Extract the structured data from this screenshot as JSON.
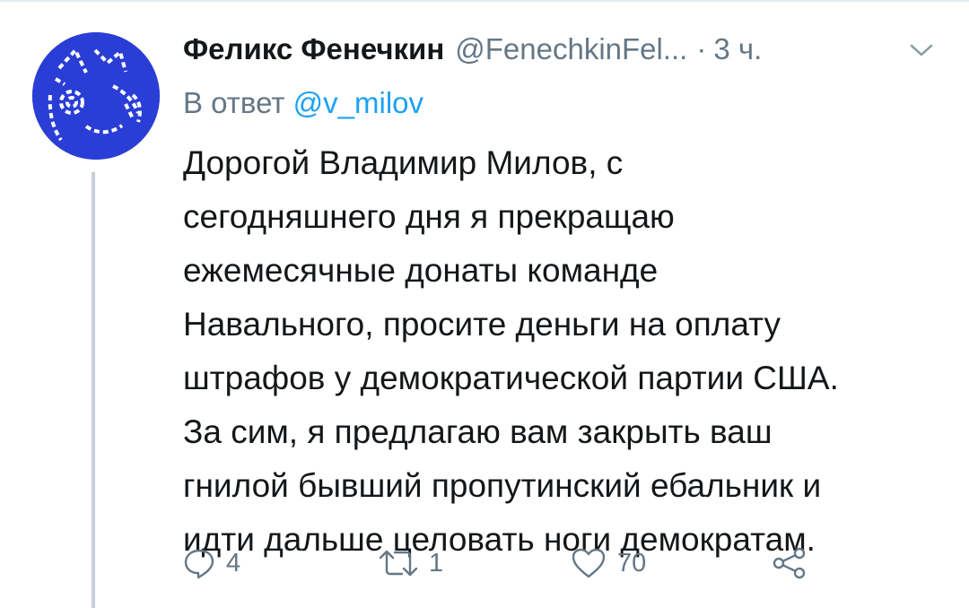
{
  "tweet": {
    "author_name": "Феликс Фенечкин",
    "author_handle": "@FenechkinFel...",
    "separator": "·",
    "time": "3 ч.",
    "reply_prefix": "В ответ",
    "reply_mention": "@v_milov",
    "text_lines": [
      "Дорогой Владимир Милов, с",
      "сегодняшнего дня я прекращаю",
      "ежемесячные донаты команде",
      "Навального, просите деньги на оплату",
      "штрафов у демократической партии США.",
      "За сим, я предлагаю вам закрыть ваш",
      "гнилой бывший пропутинский ебальник и",
      "идти дальше целовать ноги демократам."
    ]
  },
  "actions": {
    "reply_count": "4",
    "retweet_count": "1",
    "like_count": "70"
  },
  "colors": {
    "avatar_bg": "#2a3ed6",
    "secondary_text": "#657786",
    "link": "#1da1f2",
    "thread_line": "#c7d0d8"
  },
  "icons": [
    "caret-down-icon",
    "reply-icon",
    "retweet-icon",
    "like-icon",
    "share-icon"
  ]
}
